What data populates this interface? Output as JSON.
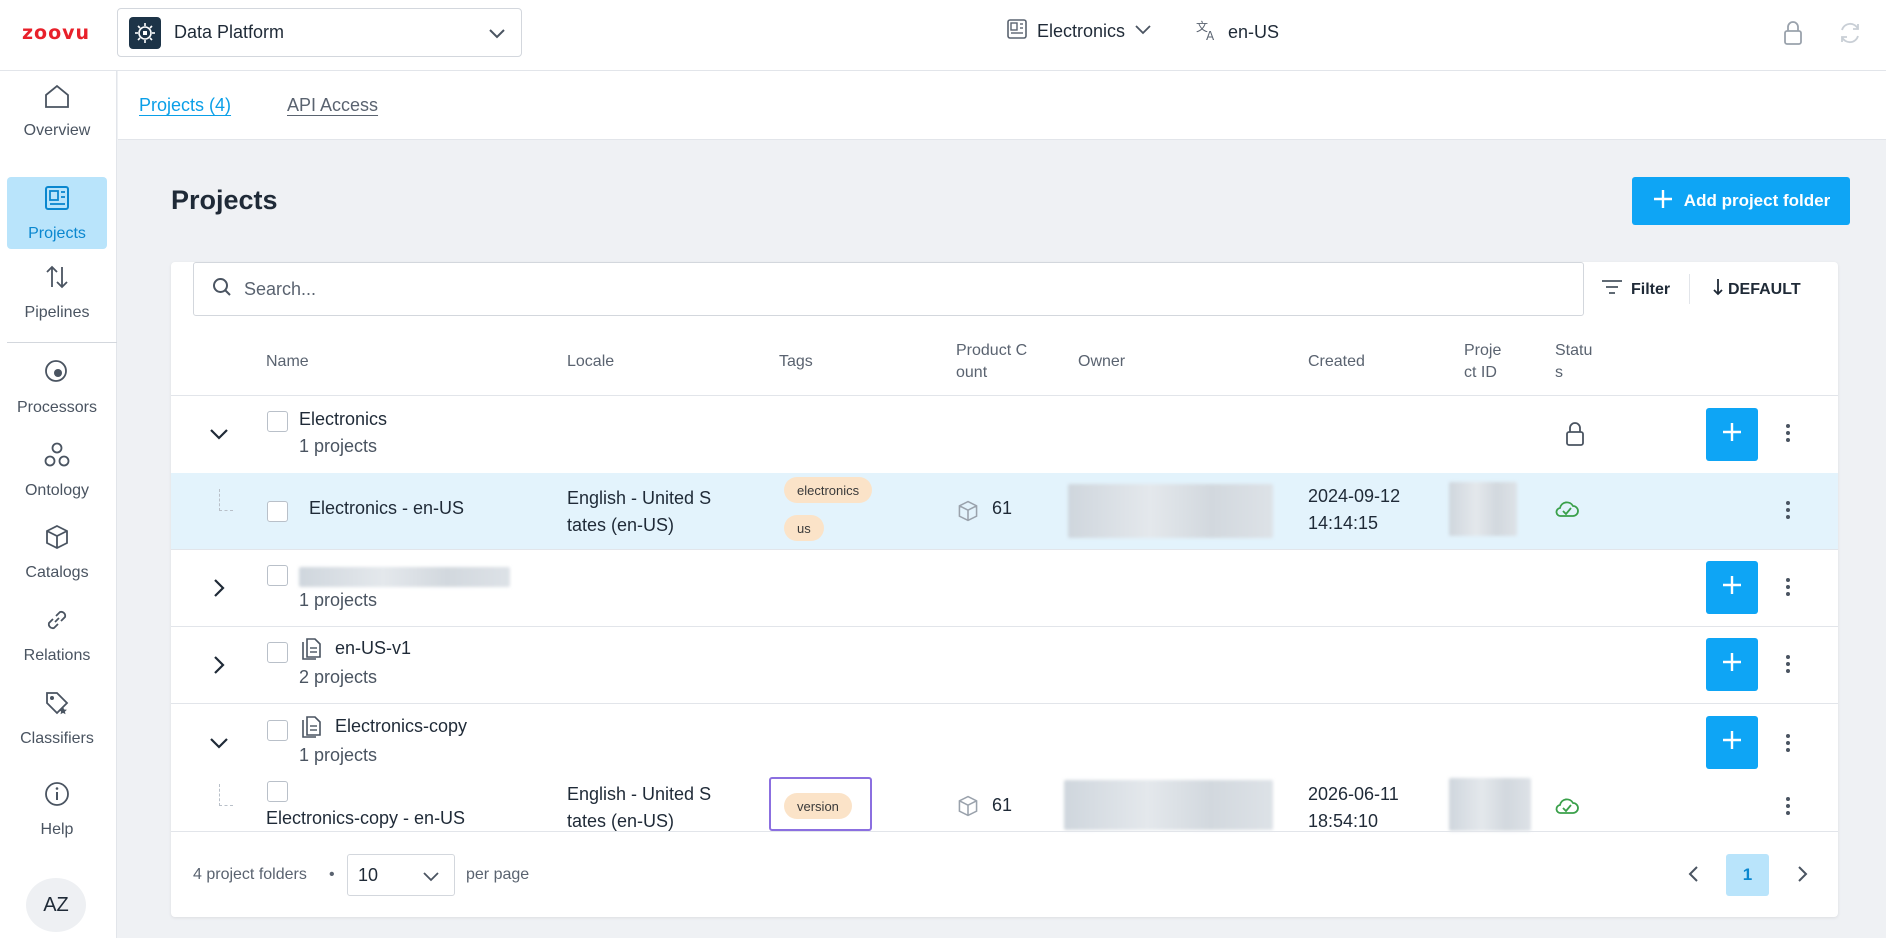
{
  "header": {
    "logo": "zoovu",
    "platform": "Data Platform",
    "catalog": "Electronics",
    "locale": "en-US"
  },
  "sidebar": {
    "items": [
      {
        "label": "Overview",
        "icon": "home-icon"
      },
      {
        "label": "Projects",
        "icon": "projects-icon",
        "active": true
      },
      {
        "label": "Pipelines",
        "icon": "pipelines-icon"
      },
      {
        "label": "Processors",
        "icon": "processors-icon"
      },
      {
        "label": "Ontology",
        "icon": "ontology-icon"
      },
      {
        "label": "Catalogs",
        "icon": "cube-icon"
      },
      {
        "label": "Relations",
        "icon": "link-icon"
      },
      {
        "label": "Classifiers",
        "icon": "tag-icon"
      },
      {
        "label": "Help",
        "icon": "info-icon"
      }
    ],
    "avatar": "AZ"
  },
  "subnav": {
    "tabs": [
      {
        "label": "Projects (4)",
        "active": true
      },
      {
        "label": "API Access",
        "active": false
      }
    ]
  },
  "main": {
    "title": "Projects",
    "add_button": "Add project folder",
    "search_placeholder": "Search...",
    "filter_label": "Filter",
    "sort_label": "DEFAULT"
  },
  "table": {
    "columns": [
      "Name",
      "Locale",
      "Tags",
      "Product C ount",
      "Owner",
      "Created",
      "Proje ct ID",
      "Statu s"
    ],
    "col_lines": {
      "product_count": [
        "Product C",
        "ount"
      ],
      "project_id": [
        "Proje",
        "ct ID"
      ],
      "status": [
        "Statu",
        "s"
      ]
    },
    "rows": [
      {
        "type": "folder",
        "name": "Electronics",
        "count": "1 projects",
        "expanded": true,
        "status_icon": "lock-icon"
      },
      {
        "type": "project",
        "name": "Electronics - en-US",
        "locale_lines": [
          "English - United S",
          "tates (en-US)"
        ],
        "tags": [
          "electronics",
          "us"
        ],
        "product_count": "61",
        "created_lines": [
          "2024-09-12",
          "14:14:15"
        ],
        "status_icon": "cloud-check-icon"
      },
      {
        "type": "folder",
        "name": "",
        "count": "1 projects",
        "expanded": false
      },
      {
        "type": "folder",
        "name": "en-US-v1",
        "count": "2 projects",
        "expanded": false
      },
      {
        "type": "folder",
        "name": "Electronics-copy",
        "count": "1 projects",
        "expanded": true
      },
      {
        "type": "project",
        "name": "Electronics-copy - en-US",
        "locale_lines": [
          "English - United S",
          "tates (en-US)"
        ],
        "tags": [
          "version"
        ],
        "product_count": "61",
        "created_lines": [
          "2026-06-11",
          "18:54:10"
        ],
        "status_icon": "cloud-check-icon"
      }
    ]
  },
  "footer": {
    "summary": "4 project folders",
    "separator": "•",
    "page_size": "10",
    "per_page_label": "per page",
    "current_page": "1"
  },
  "colors": {
    "accent": "#0ea5f5",
    "active_nav_bg": "#b9e4fb",
    "selected_row_bg": "#e3f3fc",
    "tag_bg": "#fbe3c8",
    "status_ok": "#3aa04a",
    "logo_red": "#e8202a"
  }
}
